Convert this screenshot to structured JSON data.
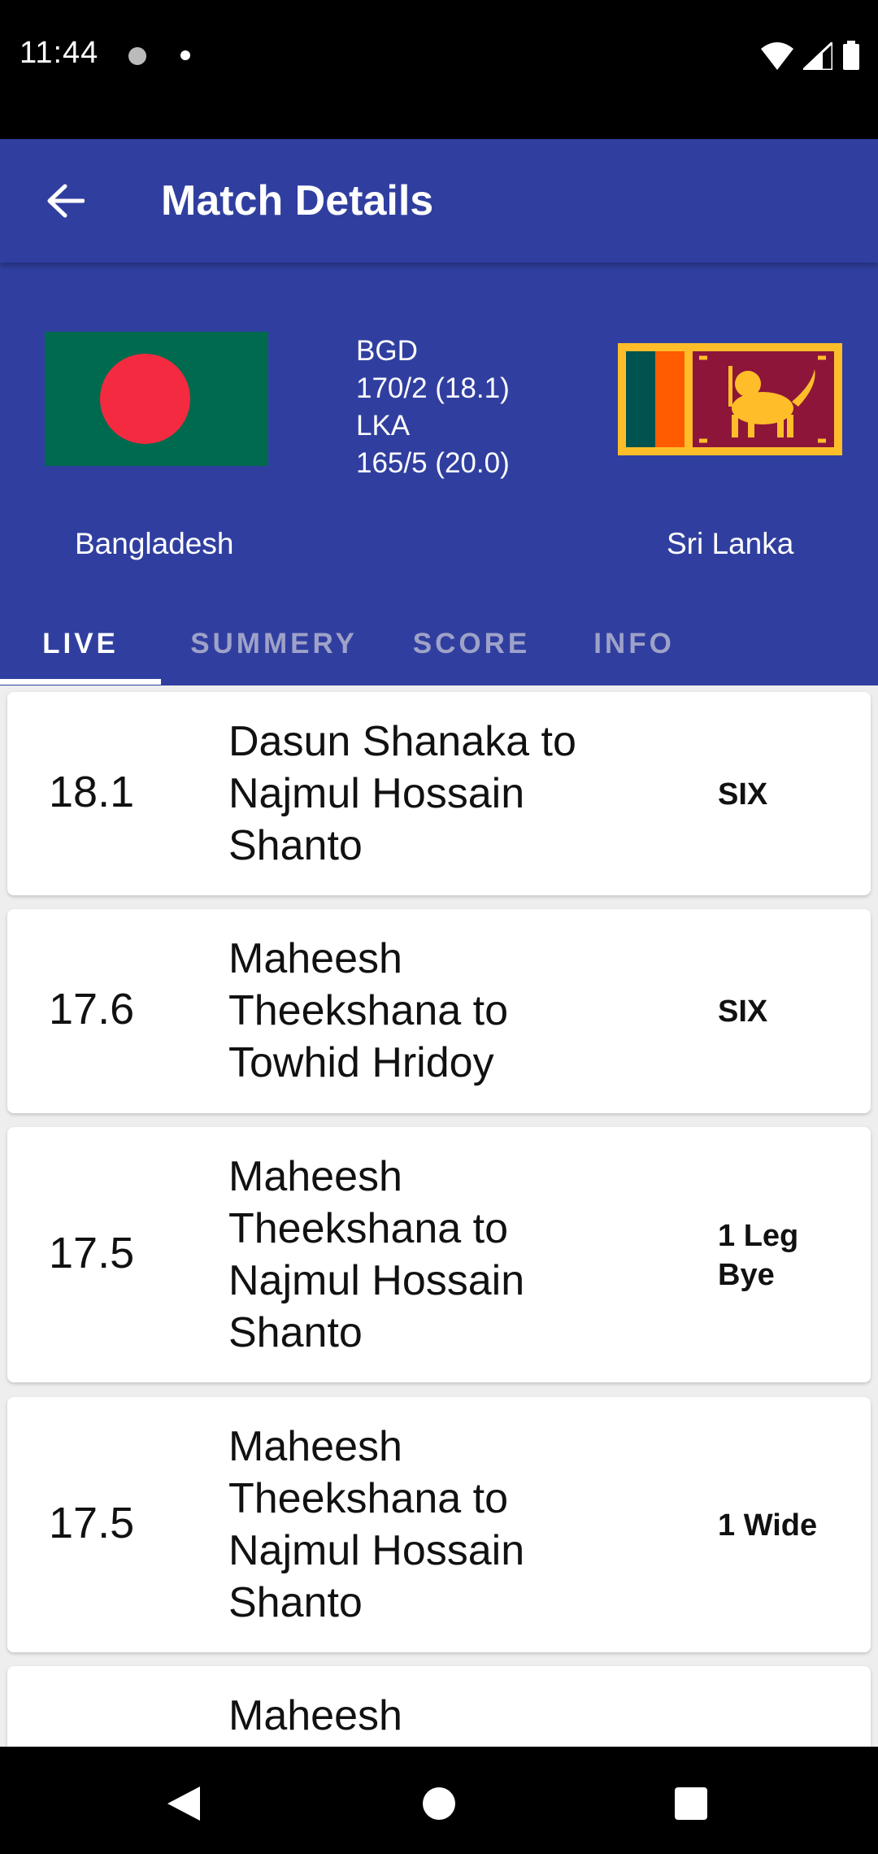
{
  "status_bar": {
    "time": "11:44"
  },
  "app_bar": {
    "title": "Match Details"
  },
  "match": {
    "home_team": "Bangladesh",
    "away_team": "Sri Lanka",
    "home_code": "BGD",
    "home_score": "170/2 (18.1)",
    "away_code": "LKA",
    "away_score": "165/5 (20.0)"
  },
  "tabs": [
    {
      "label": "LIVE",
      "active": true
    },
    {
      "label": "SUMMERY",
      "active": false
    },
    {
      "label": "SCORE",
      "active": false
    },
    {
      "label": "INFO",
      "active": false
    }
  ],
  "commentary": [
    {
      "over": "18.1",
      "description": "Dasun Shanaka to Najmul Hossain Shanto",
      "result": "SIX"
    },
    {
      "over": "17.6",
      "description": "Maheesh Theekshana to Towhid Hridoy",
      "result": "SIX"
    },
    {
      "over": "17.5",
      "description": "Maheesh Theekshana to Najmul Hossain Shanto",
      "result": "1 Leg Bye"
    },
    {
      "over": "17.5",
      "description": "Maheesh Theekshana to Najmul Hossain Shanto",
      "result": "1 Wide"
    },
    {
      "over": "",
      "description": "Maheesh",
      "result": ""
    }
  ],
  "colors": {
    "primary": "#303f9f",
    "tab_inactive": "#9fa2c8",
    "list_background": "#eeeeee"
  },
  "icons": {
    "back": "arrow-left-icon",
    "nav_back": "triangle-back-icon",
    "nav_home": "circle-home-icon",
    "nav_recents": "square-recents-icon"
  }
}
